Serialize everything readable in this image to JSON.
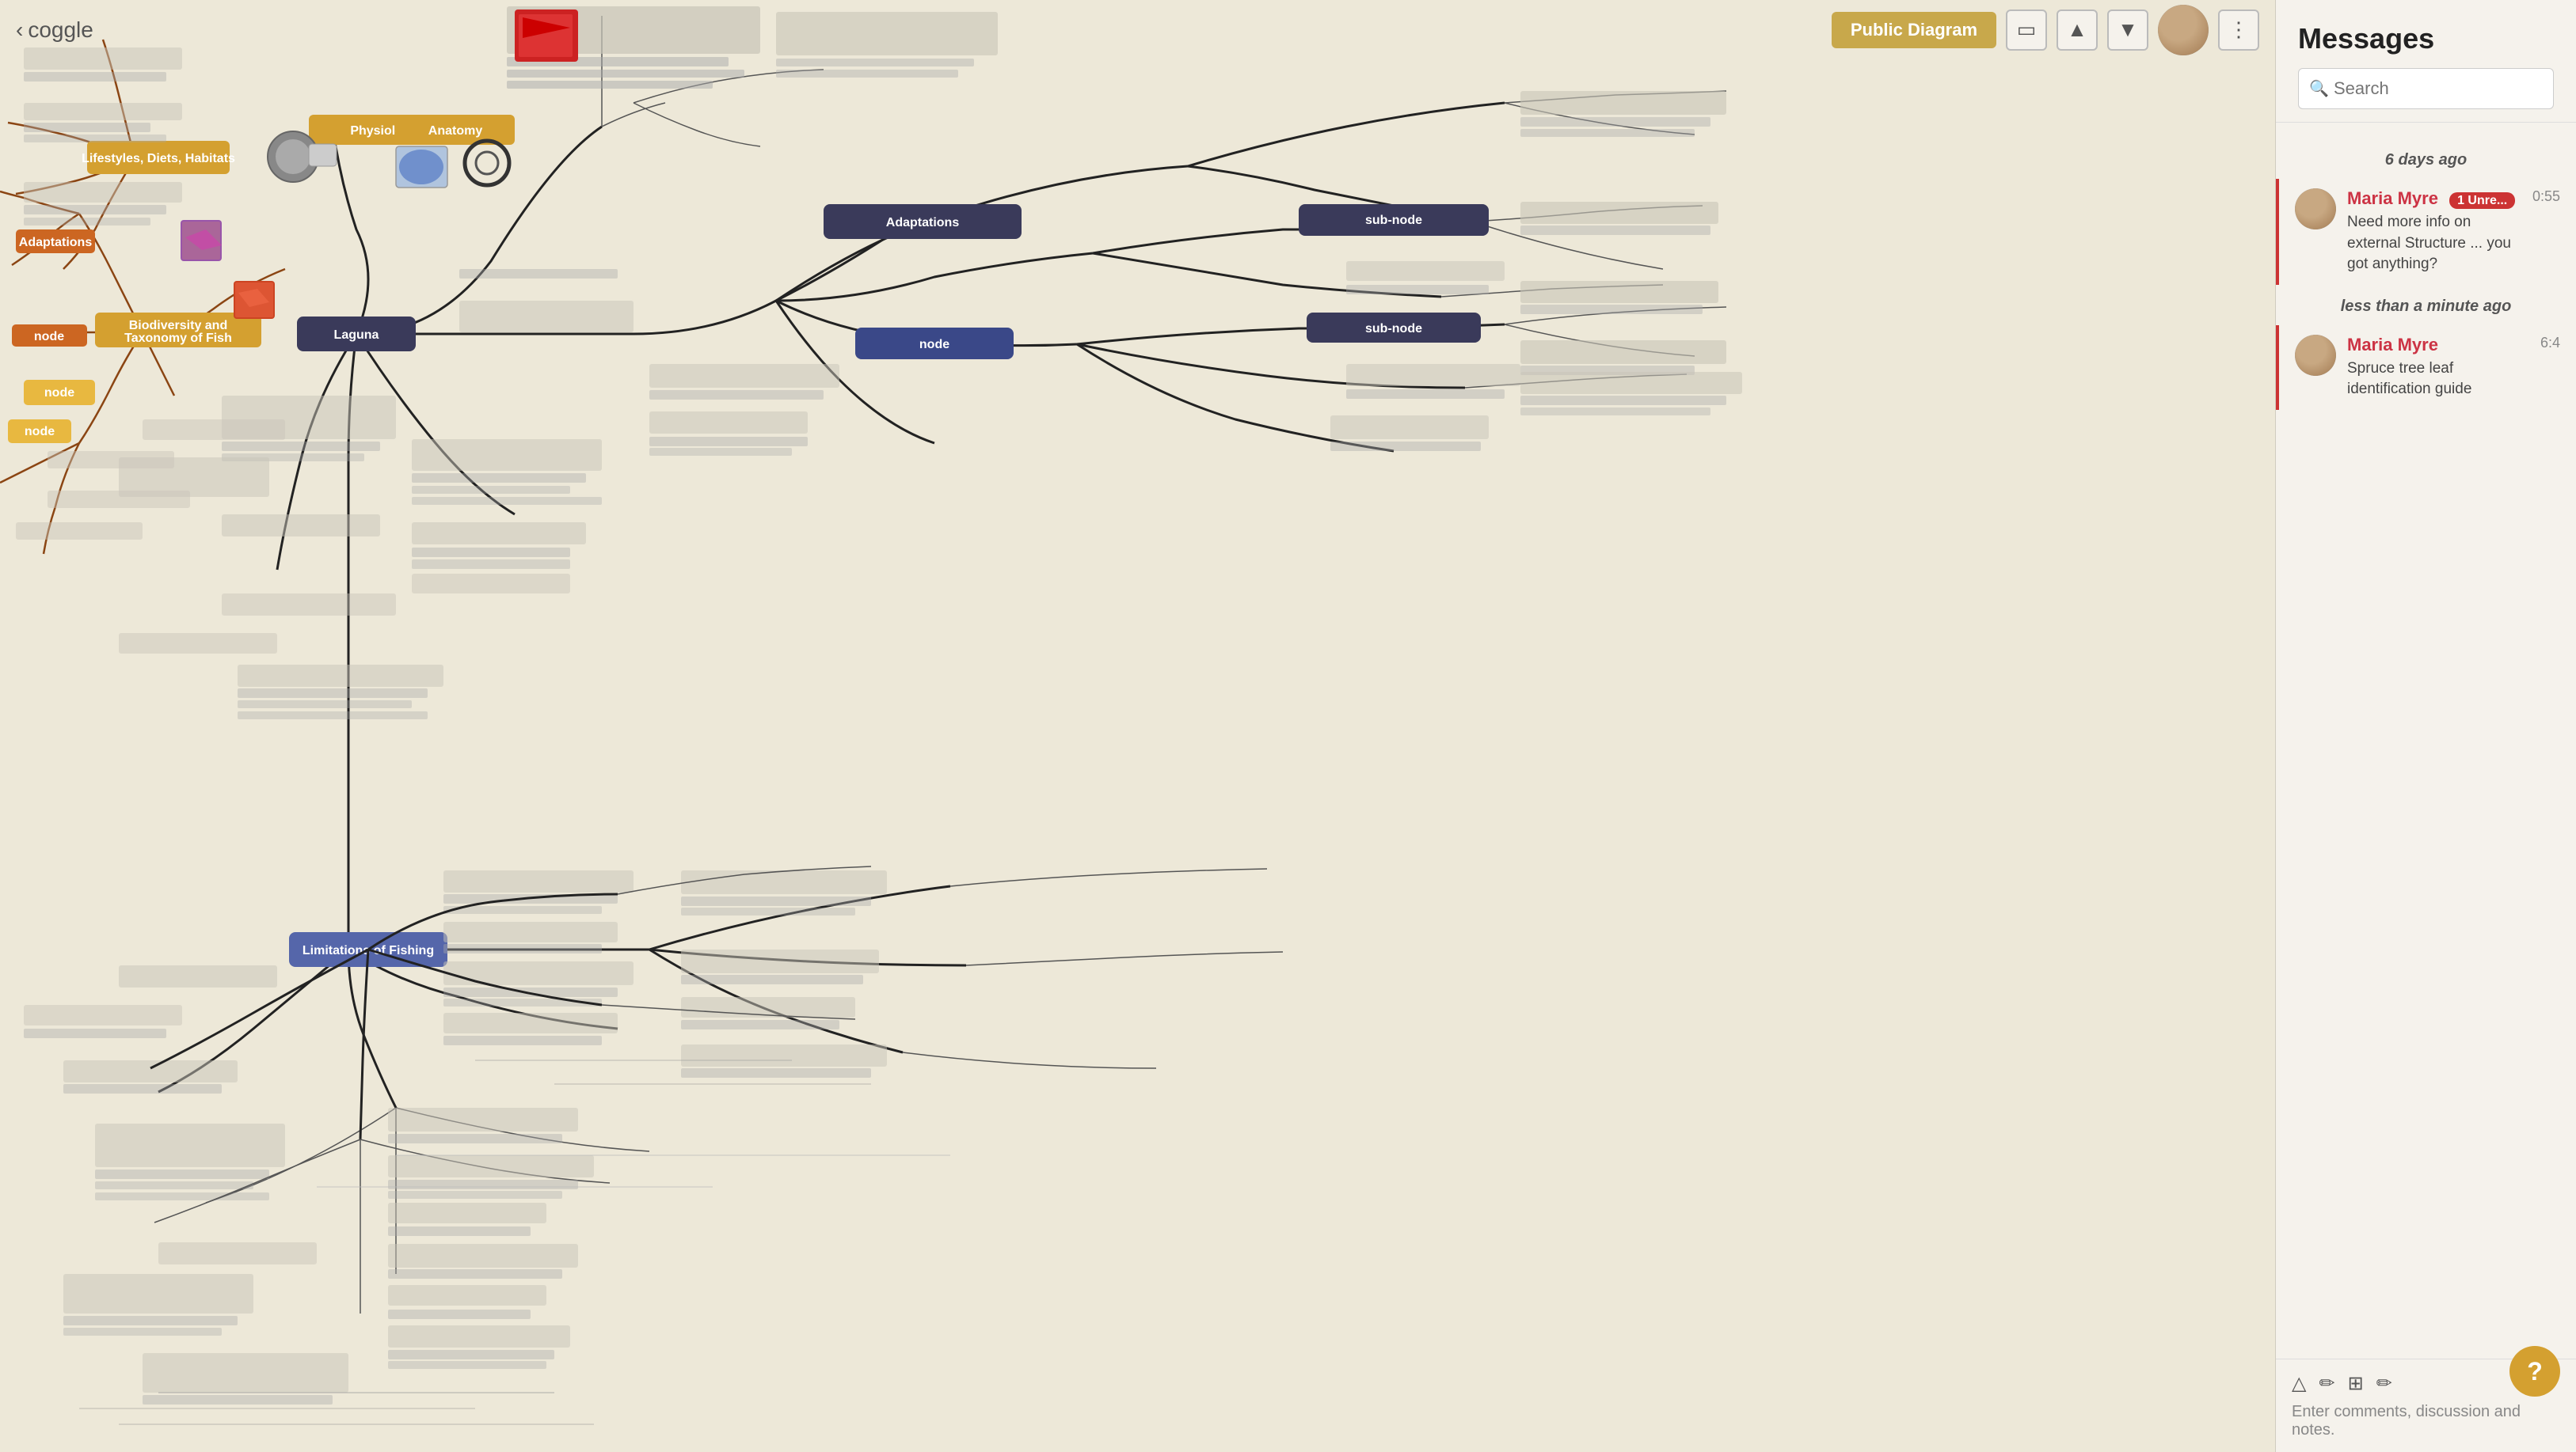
{
  "app": {
    "title": "coggle",
    "back_label": "coggle"
  },
  "toolbar": {
    "public_diagram_label": "Public Diagram",
    "monitor_icon": "monitor",
    "up_icon": "up",
    "down_icon": "down",
    "settings_icon": "settings"
  },
  "messages": {
    "panel_title": "Messages",
    "search_placeholder": "Search",
    "time_labels": [
      "6 days ago",
      "less than a minute ago"
    ],
    "items": [
      {
        "sender": "Maria Myre",
        "time": "0:55",
        "text": "Need more info on external Structure ... you got anything?",
        "unread_count": "1 Unre...",
        "is_unread": true
      },
      {
        "sender": "Maria Myre",
        "time": "6:4",
        "text": "Spruce tree leaf identification guide",
        "unread_count": null,
        "is_unread": true
      }
    ],
    "footer_placeholder": "Enter comments, discussion and notes.",
    "help_label": "?"
  },
  "mindmap": {
    "center_node": "Laguna",
    "center2_node": "Limitations of Fishing",
    "nodes": [
      {
        "label": "Biodiversity and Taxonomy of Fish",
        "color": "gold"
      },
      {
        "label": "Lifestyles, Diets, Habitats",
        "color": "gold"
      },
      {
        "label": "Physiology and Anatomy",
        "color": "gold"
      },
      {
        "label": "Adaptations",
        "color": "gold"
      }
    ]
  },
  "icons": {
    "search": "🔍",
    "monitor": "□",
    "up_arrow": "▲",
    "down_arrow": "▼",
    "pencil": "✏",
    "image": "🖼",
    "link": "🔗",
    "help": "?"
  }
}
